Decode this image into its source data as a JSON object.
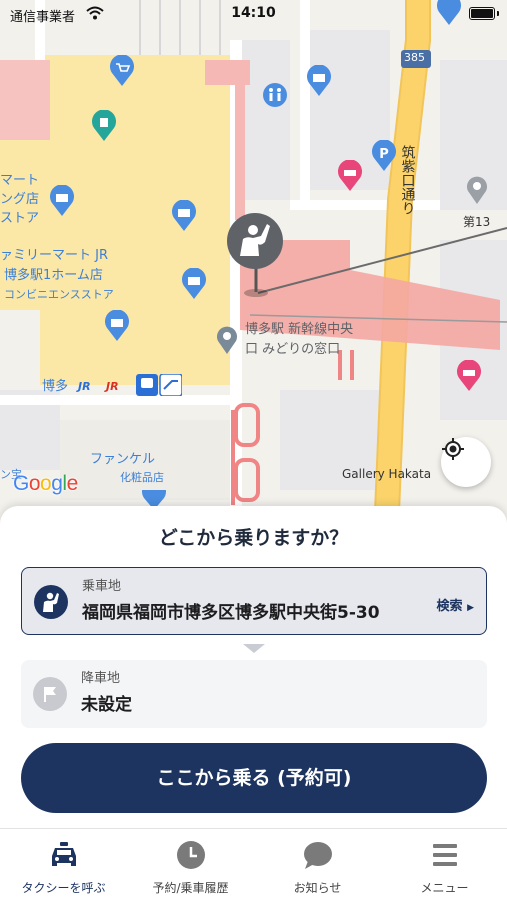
{
  "status_bar": {
    "carrier": "通信事業者",
    "time": "14:10"
  },
  "map": {
    "labels": {
      "mart": "マート",
      "ng_store": "ング店",
      "store": "ストア",
      "familymart_jr": "ァミリーマート JR",
      "hakata_1home": "博多駅1ホーム店",
      "convenience": "コンビニエンスストア",
      "hakata": "博多",
      "jr": "JR",
      "shinkansen_1": "博多駅 新幹線中央",
      "shinkansen_2": "口 みどりの窓口",
      "chikushi_st": "筑紫口通り",
      "fancl": "ファンケル",
      "cosmetics": "化粧品店",
      "gallery": "Gallery Hakata",
      "dai13": "第13",
      "route": "385",
      "google": "Google",
      "google_g1": "G",
      "google_o1": "o",
      "google_o2": "o",
      "google_g2": "g",
      "google_l": "l",
      "google_e": "e",
      "edge_label": "ン宝"
    },
    "colors": {
      "station_area": "#f4a7a3",
      "station_yellow": "#fbe7a6",
      "road_major": "#fbd36a",
      "poi_blue": "#4a8de0",
      "poi_pink": "#e8457b"
    }
  },
  "sheet": {
    "title": "どこから乗りますか？",
    "pickup": {
      "caption": "乗車地",
      "address": "福岡県福岡市博多区博多駅中央街5-30",
      "search": "検索"
    },
    "dropoff": {
      "caption": "降車地",
      "value": "未設定"
    },
    "ride_button": "ここから乗る (予約可)"
  },
  "tabs": [
    {
      "label": "タクシーを呼ぶ",
      "icon": "taxi-icon",
      "active": true
    },
    {
      "label": "予約/乗車履歴",
      "icon": "clock-icon",
      "active": false
    },
    {
      "label": "お知らせ",
      "icon": "chat-bubble-icon",
      "active": false
    },
    {
      "label": "メニュー",
      "icon": "menu-icon",
      "active": false
    }
  ]
}
